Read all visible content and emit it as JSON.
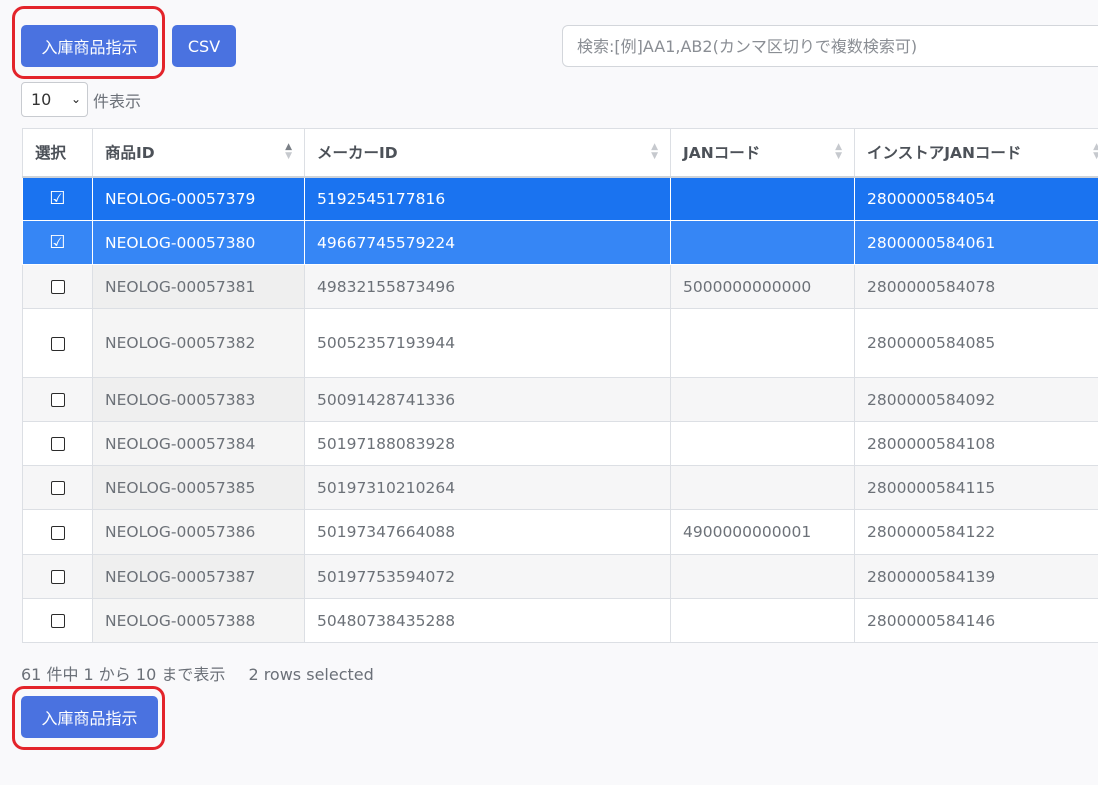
{
  "toolbar": {
    "instruct_label": "入庫商品指示",
    "csv_label": "CSV",
    "bottom_instruct_label": "入庫商品指示"
  },
  "search": {
    "placeholder": "検索:[例]AA1,AB2(カンマ区切りで複数検索可)"
  },
  "length": {
    "value": "10",
    "label": "件表示"
  },
  "table": {
    "headers": [
      "選択",
      "商品ID",
      "メーカーID",
      "JANコード",
      "インストアJANコード"
    ],
    "rows": [
      {
        "selected": true,
        "product_id": "NEOLOG-00057379",
        "maker_id": "5192545177816",
        "jan": "",
        "instore_jan": "2800000584054"
      },
      {
        "selected": true,
        "product_id": "NEOLOG-00057380",
        "maker_id": "49667745579224",
        "jan": "",
        "instore_jan": "2800000584061"
      },
      {
        "selected": false,
        "product_id": "NEOLOG-00057381",
        "maker_id": "49832155873496",
        "jan": "5000000000000",
        "instore_jan": "2800000584078"
      },
      {
        "selected": false,
        "product_id": "NEOLOG-00057382",
        "maker_id": "50052357193944",
        "jan": "",
        "instore_jan": "2800000584085"
      },
      {
        "selected": false,
        "product_id": "NEOLOG-00057383",
        "maker_id": "50091428741336",
        "jan": "",
        "instore_jan": "2800000584092"
      },
      {
        "selected": false,
        "product_id": "NEOLOG-00057384",
        "maker_id": "50197188083928",
        "jan": "",
        "instore_jan": "2800000584108"
      },
      {
        "selected": false,
        "product_id": "NEOLOG-00057385",
        "maker_id": "50197310210264",
        "jan": "",
        "instore_jan": "2800000584115"
      },
      {
        "selected": false,
        "product_id": "NEOLOG-00057386",
        "maker_id": "50197347664088",
        "jan": "4900000000001",
        "instore_jan": "2800000584122"
      },
      {
        "selected": false,
        "product_id": "NEOLOG-00057387",
        "maker_id": "50197753594072",
        "jan": "",
        "instore_jan": "2800000584139"
      },
      {
        "selected": false,
        "product_id": "NEOLOG-00057388",
        "maker_id": "50480738435288",
        "jan": "",
        "instore_jan": "2800000584146"
      }
    ]
  },
  "info": {
    "summary": "61 件中 1 から 10 まで表示",
    "selected": "2 rows selected"
  },
  "colors": {
    "accent": "#4a72e0",
    "selected_row": "#1a73f0",
    "highlight": "#e3242b"
  }
}
